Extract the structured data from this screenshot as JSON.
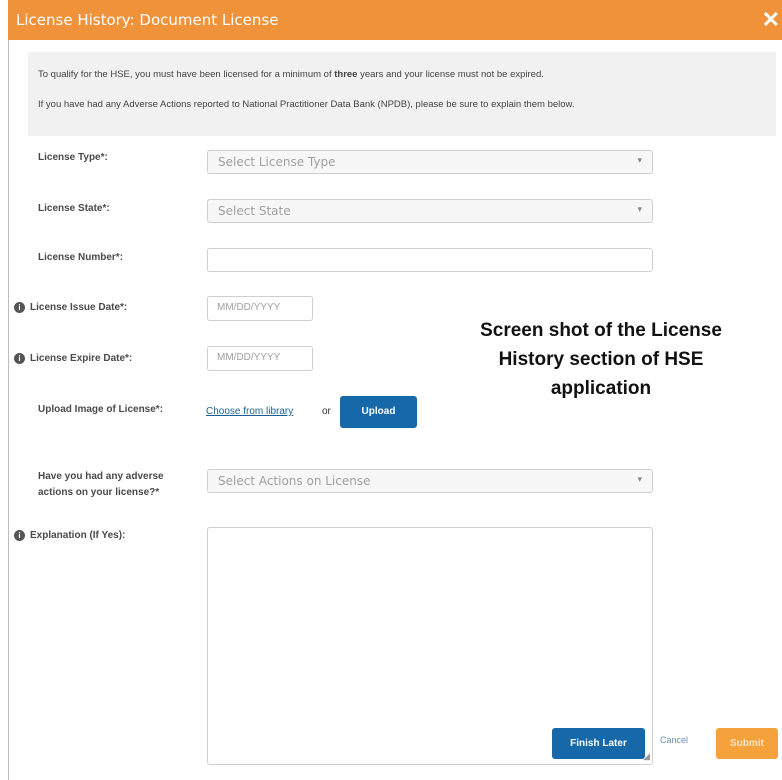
{
  "dialog": {
    "title": "License History: Document License",
    "close_glyph": "✕"
  },
  "info": {
    "line1_prefix": "To qualify for the HSE, you must have been licensed for a minimum of ",
    "line1_bold": "three",
    "line1_suffix": " years and your license must not be expired.",
    "line2": "If you have had any Adverse Actions reported to National Practitioner Data Bank (NPDB), please be sure to explain them below."
  },
  "form": {
    "license_type": {
      "label": "License Type*:",
      "placeholder": "Select License Type"
    },
    "license_state": {
      "label": "License State*:",
      "placeholder": "Select State"
    },
    "license_number": {
      "label": "License Number*:",
      "value": ""
    },
    "issue_date": {
      "label": "License Issue Date*:",
      "placeholder": "MM/DD/YYYY"
    },
    "expire_date": {
      "label": "License Expire Date*:",
      "placeholder": "MM/DD/YYYY"
    },
    "upload": {
      "label": "Upload Image of License*:",
      "link": "Choose from library",
      "or": "or",
      "button": "Upload"
    },
    "adverse": {
      "label_line1": "Have you had any adverse",
      "label_line2": "actions on your license?*",
      "placeholder": "Select Actions on License"
    },
    "explanation": {
      "label": "Explanation (If Yes):",
      "value": ""
    }
  },
  "footer": {
    "finish_later": "Finish Later",
    "cancel": "Cancel",
    "submit": "Submit"
  },
  "caption": {
    "line1": "Screen shot of the License",
    "line2": "History section of HSE",
    "line3": "application"
  },
  "icons": {
    "info_glyph": "i",
    "chevron_glyph": "▾",
    "resize_glyph": "◢"
  },
  "colors": {
    "titlebar": "#f0923a",
    "primary_button": "#1768a8",
    "submit_button": "#f5a23d"
  }
}
